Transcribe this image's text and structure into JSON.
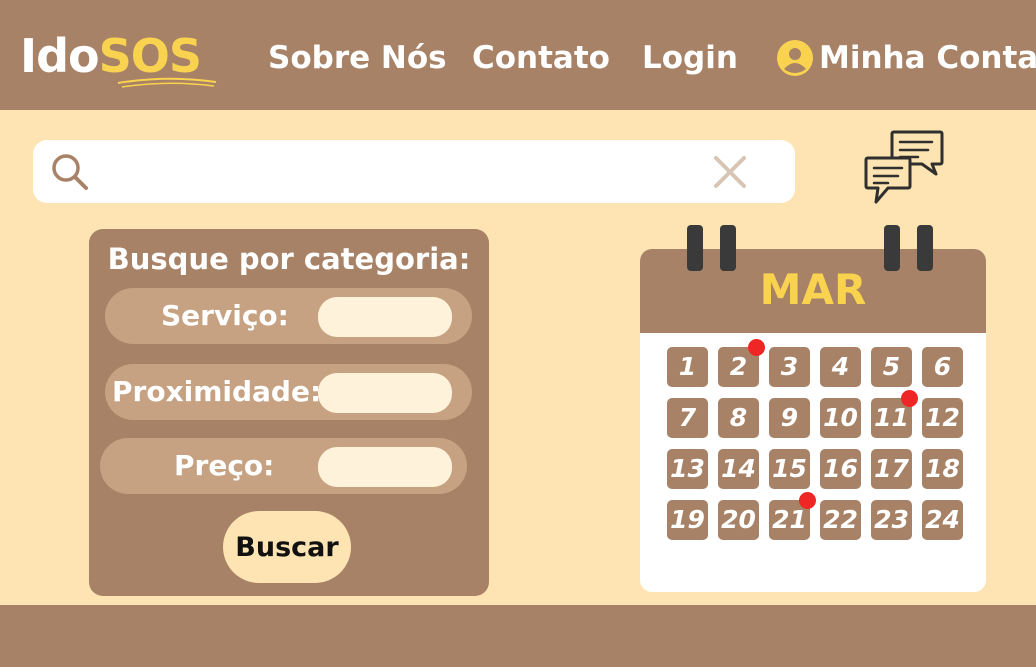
{
  "brand": {
    "logo_part1": "Ido",
    "logo_part2": "SOS"
  },
  "nav": {
    "about": "Sobre Nós",
    "contact": "Contato",
    "login": "Login",
    "account": "Minha Conta"
  },
  "search": {
    "value": "",
    "placeholder": ""
  },
  "categories": {
    "title": "Busque por categoria:",
    "service_label": "Serviço:",
    "proximity_label": "Proximidade:",
    "price_label": "Preço:",
    "submit_label": "Buscar"
  },
  "calendar": {
    "month": "MAR",
    "days": [
      "1",
      "2",
      "3",
      "4",
      "5",
      "6",
      "7",
      "8",
      "9",
      "10",
      "11",
      "12",
      "13",
      "14",
      "15",
      "16",
      "17",
      "18",
      "19",
      "20",
      "21",
      "22",
      "23",
      "24"
    ],
    "marked_days": [
      "2",
      "11",
      "21"
    ]
  },
  "icons": {
    "search": "search-icon",
    "clear": "close-icon",
    "chat": "chat-bubbles-icon",
    "user": "user-circle-icon"
  },
  "colors": {
    "brown": "#a78266",
    "cream": "#fde4b2",
    "yellow": "#f9d34f",
    "marker": "#ee2626"
  }
}
